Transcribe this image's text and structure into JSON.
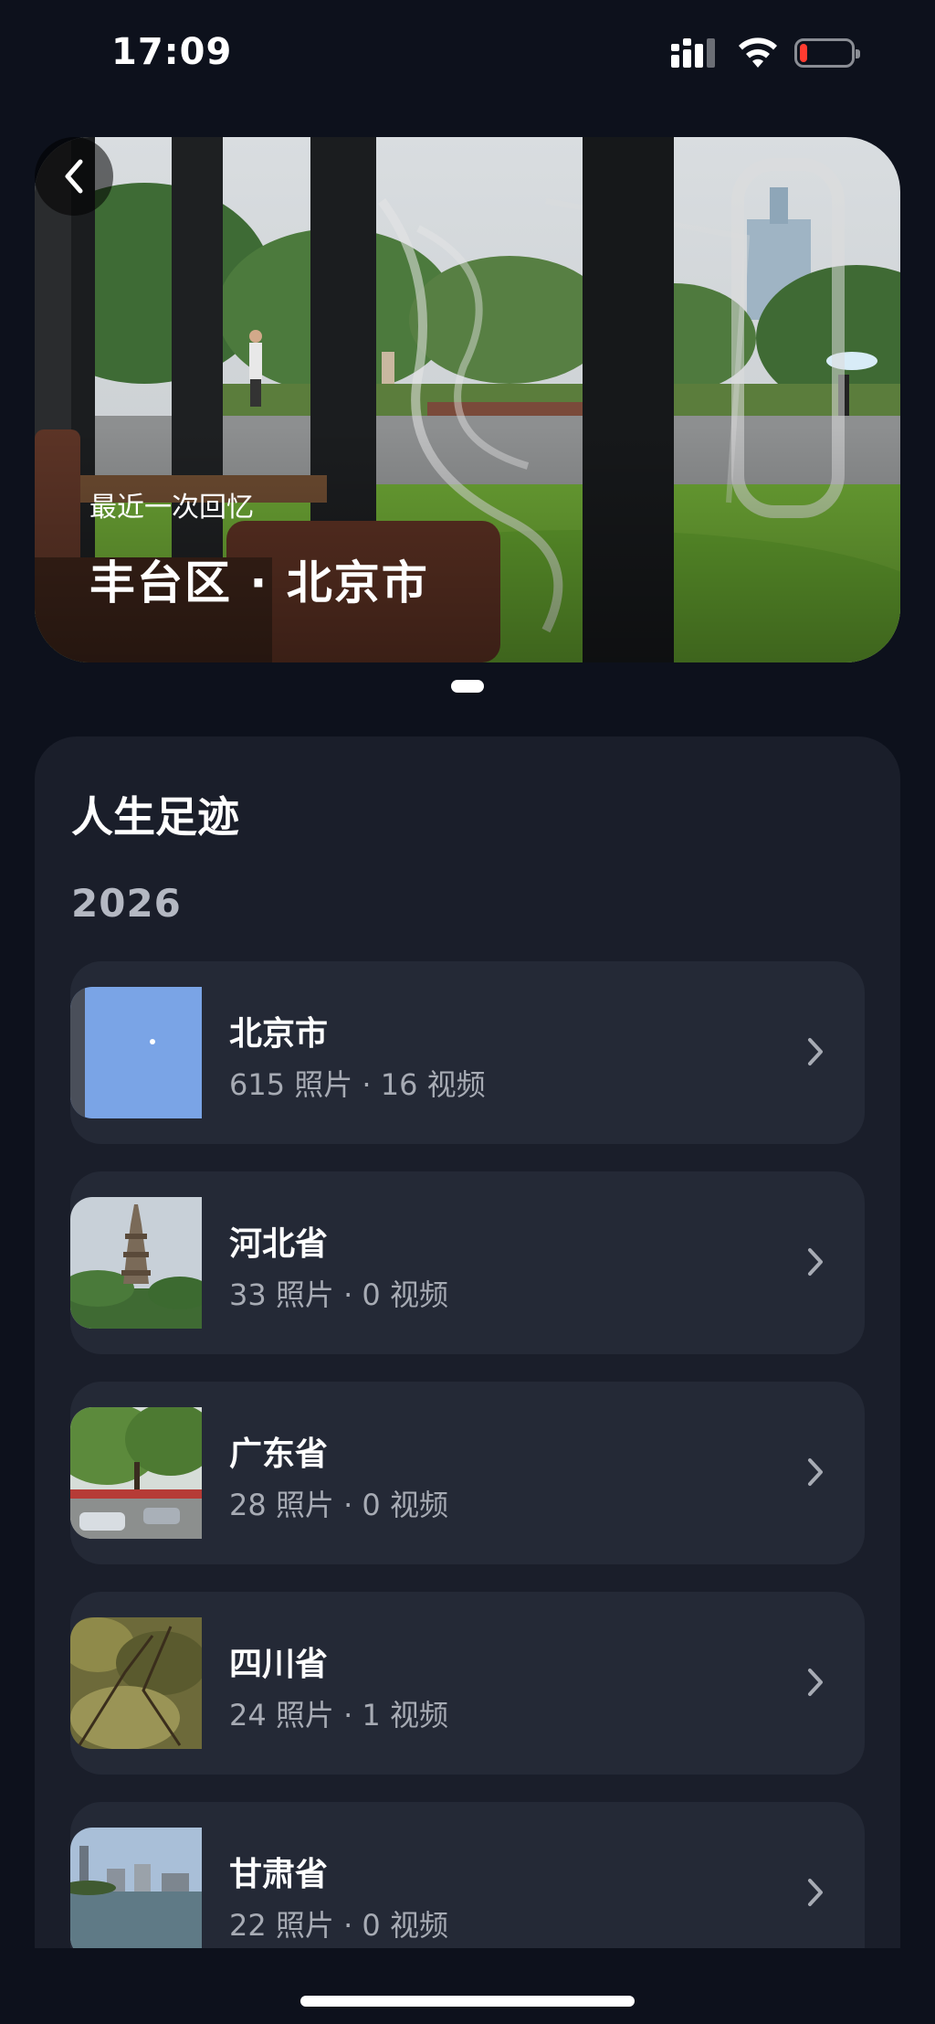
{
  "status_bar": {
    "time": "17:09",
    "battery_level": 0.15,
    "battery_color": "#ff3b30"
  },
  "hero": {
    "subtitle": "最近一次回忆",
    "title": "丰台区 · 北京市",
    "back_icon": "chevron-left-icon",
    "page_count": 1,
    "current_page": 1
  },
  "footprints": {
    "title": "人生足迹",
    "year": "2026",
    "items": [
      {
        "name": "北京市",
        "meta": "615 照片 · 16 视频",
        "thumb": "sky-photo"
      },
      {
        "name": "河北省",
        "meta": "33 照片 · 0 视频",
        "thumb": "pagoda-photo"
      },
      {
        "name": "广东省",
        "meta": "28 照片 · 0 视频",
        "thumb": "trees-street-photo"
      },
      {
        "name": "四川省",
        "meta": "24 照片 · 1 视频",
        "thumb": "foliage-photo"
      },
      {
        "name": "甘肃省",
        "meta": "22 照片 · 0 视频",
        "thumb": "city-river-photo"
      }
    ]
  },
  "colors": {
    "background": "#0d111c",
    "panel": "#1a1e2a",
    "card": "#242936",
    "secondary_text": "#a7abb4"
  }
}
